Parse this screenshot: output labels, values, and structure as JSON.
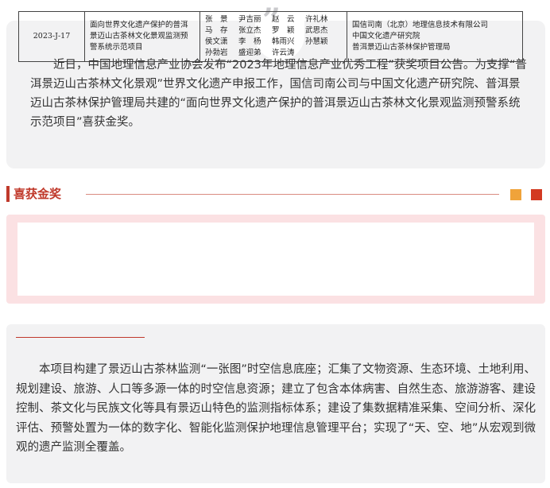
{
  "intro": {
    "text": "近日，中国地理信息产业协会发布“2023年地理信息产业优秀工程”获奖项目公告。为支撑“普洱景迈山古茶林文化景观”世界文化遗产申报工作，国信司南公司与中国文化遗产研究院、普洱景迈山古茶林保护管理局共建的“面向世界文化遗产保护的普洱景迈山古茶林文化景观监测预警系统示范项目”喜获金奖。"
  },
  "section": {
    "title": "喜获金奖"
  },
  "award": {
    "code": "2023-J-17",
    "project_name": "面向世界文化遗产保护的普洱景迈山古茶林文化景观监测预警系统示范项目",
    "people_rows": [
      [
        "张　景",
        "尹吉丽",
        "赵　云",
        "许礼林"
      ],
      [
        "马　存",
        "张立杰",
        "罗　颖",
        "武思杰"
      ],
      [
        "侯文潇",
        "李　杨",
        "韩雨兴",
        "孙慧颖"
      ],
      [
        "孙勃岩",
        "盛迎弟",
        "许云涛"
      ]
    ],
    "organizations": [
      "国信司南（北京）地理信息技术有限公司",
      "中国文化遗产研究院",
      "普洱景迈山古茶林保护管理局"
    ]
  },
  "body": {
    "text": "本项目构建了景迈山古茶林监测“一张图”时空信息底座；汇集了文物资源、生态环境、土地利用、规划建设、旅游、人口等多源一体的时空信息资源；建立了包含本体病害、自然生态、旅游游客、建设控制、茶文化与民族文化等具有景迈山特色的监测指标体系；建设了集数据精准采集、空间分析、深化评估、预警处置为一体的数字化、智能化监测保护地理信息管理平台；实现了“天、空、地”从宏观到微观的遗产监测全覆盖。"
  },
  "colors": {
    "accent_red": "#c0392b",
    "square_orange": "#f0a33a",
    "square_red": "#d33a22",
    "panel_pink": "#fbe1e3",
    "card_gray": "#f2f2f3"
  },
  "icons": {
    "quote": "quote-icon"
  }
}
